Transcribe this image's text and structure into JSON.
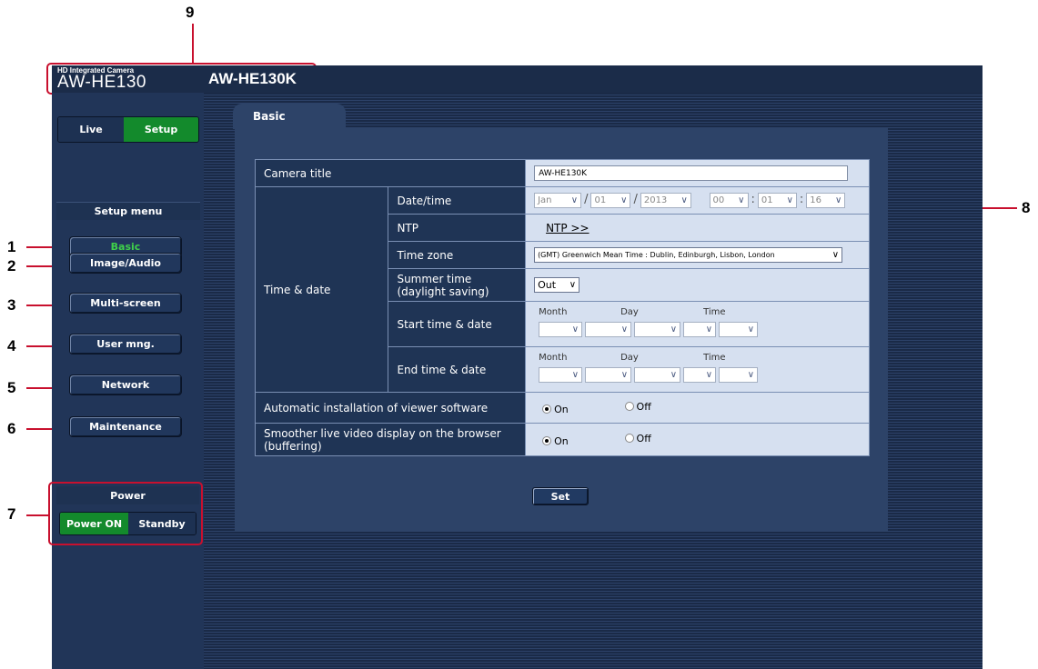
{
  "callouts": {
    "c1": "1",
    "c2": "2",
    "c3": "3",
    "c4": "4",
    "c5": "5",
    "c6": "6",
    "c7": "7",
    "c8": "8",
    "c9": "9"
  },
  "header": {
    "brand_line": "HD Integrated Camera",
    "brand_model": "AW-HE130",
    "camera_name": "AW-HE130K"
  },
  "mode": {
    "live": "Live",
    "setup": "Setup"
  },
  "sidebar": {
    "menu_title": "Setup menu",
    "items": [
      {
        "label": "Basic"
      },
      {
        "label": "Image/Audio"
      },
      {
        "label": "Multi-screen"
      },
      {
        "label": "User mng."
      },
      {
        "label": "Network"
      },
      {
        "label": "Maintenance"
      }
    ],
    "power_title": "Power",
    "power_on": "Power ON",
    "standby": "Standby"
  },
  "tab": {
    "label": "Basic"
  },
  "form": {
    "camera_title": {
      "label": "Camera title",
      "value": "AW-HE130K"
    },
    "time_date": {
      "label": "Time & date"
    },
    "datetime": {
      "label": "Date/time",
      "month": "Jan",
      "day": "01",
      "year": "2013",
      "hour": "00",
      "minute": "01",
      "second": "16"
    },
    "ntp": {
      "label": "NTP",
      "link": "NTP >>"
    },
    "time_zone": {
      "label": "Time zone",
      "value": "(GMT) Greenwich Mean Time : Dublin, Edinburgh, Lisbon, London"
    },
    "summer_time": {
      "label_1": "Summer time",
      "label_2": "(daylight saving)",
      "value": "Out"
    },
    "start": {
      "label": "Start time & date",
      "month_lbl": "Month",
      "day_lbl": "Day",
      "time_lbl": "Time"
    },
    "end": {
      "label": "End time & date",
      "month_lbl": "Month",
      "day_lbl": "Day",
      "time_lbl": "Time"
    },
    "auto_install": {
      "label": "Automatic installation of viewer software",
      "on": "On",
      "off": "Off"
    },
    "smoother": {
      "label_1": "Smoother live video display on the browser",
      "label_2": "(buffering)",
      "on": "On",
      "off": "Off"
    },
    "set_label": "Set"
  },
  "colors": {
    "accent_green": "#138a2c",
    "active_text": "#3fd14a",
    "callout_red": "#c8102e"
  }
}
